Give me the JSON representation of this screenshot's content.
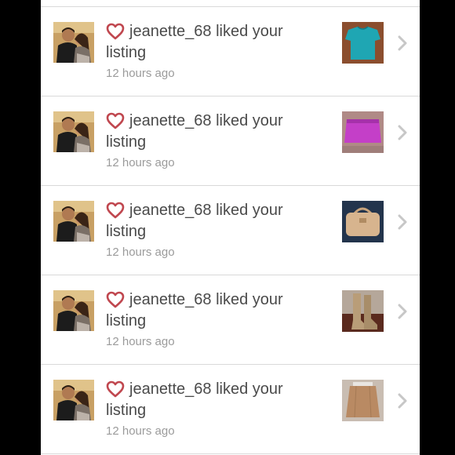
{
  "notifications": [
    {
      "user": "jeanette_68",
      "message": "liked your",
      "message_cont": "listing",
      "time": "12 hours ago",
      "item": "teal-top-thumbnail",
      "colors": {
        "bg": "#8b4e2e",
        "item": "#1fa6b3"
      }
    },
    {
      "user": "jeanette_68",
      "message": "liked your",
      "message_cont": "listing",
      "time": "12 hours ago",
      "item": "pink-skirt-thumbnail",
      "colors": {
        "bg": "#b08a86",
        "item": "#c43fc8"
      }
    },
    {
      "user": "jeanette_68",
      "message": "liked your",
      "message_cont": "listing",
      "time": "12 hours ago",
      "item": "tan-handbag-thumbnail",
      "colors": {
        "bg": "#23344c",
        "item": "#d7b48e"
      }
    },
    {
      "user": "jeanette_68",
      "message": "liked your",
      "message_cont": "listing",
      "time": "12 hours ago",
      "item": "boots-thumbnail",
      "colors": {
        "bg": "#5a2a1e",
        "item": "#b99d78"
      }
    },
    {
      "user": "jeanette_68",
      "message": "liked your",
      "message_cont": "listing",
      "time": "12 hours ago",
      "item": "beige-skirt-thumbnail",
      "colors": {
        "bg": "#c9bdb2",
        "item": "#b98a63"
      }
    }
  ],
  "colors": {
    "heart": "#c0474f",
    "chevron": "#c7c7c7",
    "divider": "#d9d9d9"
  }
}
